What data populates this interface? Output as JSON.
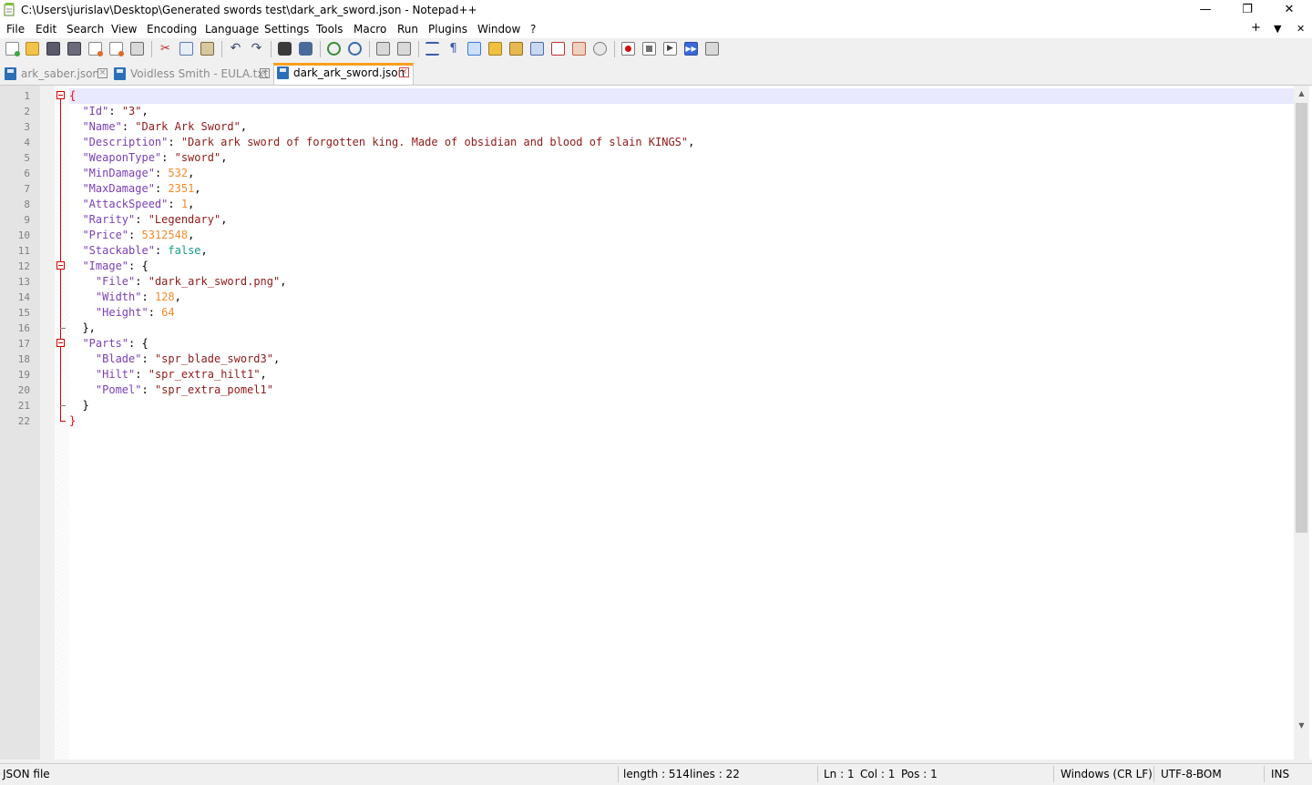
{
  "window": {
    "title": "C:\\Users\\jurislav\\Desktop\\Generated swords test\\dark_ark_sword.json - Notepad++",
    "minimize": "—",
    "maximize": "❐",
    "close": "✕"
  },
  "menu": {
    "items": [
      "File",
      "Edit",
      "Search",
      "View",
      "Encoding",
      "Language",
      "Settings",
      "Tools",
      "Macro",
      "Run",
      "Plugins",
      "Window",
      "?"
    ],
    "right_plus": "+",
    "right_down": "▼",
    "right_close": "✕"
  },
  "tabs": [
    {
      "label": "ark_saber.json",
      "active": false,
      "close": "×"
    },
    {
      "label": "Voidless Smith - EULA.txt",
      "active": false,
      "close": "×"
    },
    {
      "label": "dark_ark_sword.json",
      "active": true,
      "close": "×"
    }
  ],
  "editor": {
    "line_numbers": [
      "1",
      "2",
      "3",
      "4",
      "5",
      "6",
      "7",
      "8",
      "9",
      "10",
      "11",
      "12",
      "13",
      "14",
      "15",
      "16",
      "17",
      "18",
      "19",
      "20",
      "21",
      "22"
    ],
    "lines": [
      [
        {
          "t": "{",
          "c": "brace-hi"
        }
      ],
      [
        {
          "t": "  ",
          "c": "p"
        },
        {
          "t": "\"Id\"",
          "c": "k"
        },
        {
          "t": ": ",
          "c": "p"
        },
        {
          "t": "\"3\"",
          "c": "s"
        },
        {
          "t": ",",
          "c": "p"
        }
      ],
      [
        {
          "t": "  ",
          "c": "p"
        },
        {
          "t": "\"Name\"",
          "c": "k"
        },
        {
          "t": ": ",
          "c": "p"
        },
        {
          "t": "\"Dark Ark Sword\"",
          "c": "s"
        },
        {
          "t": ",",
          "c": "p"
        }
      ],
      [
        {
          "t": "  ",
          "c": "p"
        },
        {
          "t": "\"Description\"",
          "c": "k"
        },
        {
          "t": ": ",
          "c": "p"
        },
        {
          "t": "\"Dark ark sword of forgotten king. Made of obsidian and blood of slain KINGS\"",
          "c": "s"
        },
        {
          "t": ",",
          "c": "p"
        }
      ],
      [
        {
          "t": "  ",
          "c": "p"
        },
        {
          "t": "\"WeaponType\"",
          "c": "k"
        },
        {
          "t": ": ",
          "c": "p"
        },
        {
          "t": "\"sword\"",
          "c": "s"
        },
        {
          "t": ",",
          "c": "p"
        }
      ],
      [
        {
          "t": "  ",
          "c": "p"
        },
        {
          "t": "\"MinDamage\"",
          "c": "k"
        },
        {
          "t": ": ",
          "c": "p"
        },
        {
          "t": "532",
          "c": "n"
        },
        {
          "t": ",",
          "c": "p"
        }
      ],
      [
        {
          "t": "  ",
          "c": "p"
        },
        {
          "t": "\"MaxDamage\"",
          "c": "k"
        },
        {
          "t": ": ",
          "c": "p"
        },
        {
          "t": "2351",
          "c": "n"
        },
        {
          "t": ",",
          "c": "p"
        }
      ],
      [
        {
          "t": "  ",
          "c": "p"
        },
        {
          "t": "\"AttackSpeed\"",
          "c": "k"
        },
        {
          "t": ": ",
          "c": "p"
        },
        {
          "t": "1",
          "c": "n"
        },
        {
          "t": ",",
          "c": "p"
        }
      ],
      [
        {
          "t": "  ",
          "c": "p"
        },
        {
          "t": "\"Rarity\"",
          "c": "k"
        },
        {
          "t": ": ",
          "c": "p"
        },
        {
          "t": "\"Legendary\"",
          "c": "s"
        },
        {
          "t": ",",
          "c": "p"
        }
      ],
      [
        {
          "t": "  ",
          "c": "p"
        },
        {
          "t": "\"Price\"",
          "c": "k"
        },
        {
          "t": ": ",
          "c": "p"
        },
        {
          "t": "5312548",
          "c": "n"
        },
        {
          "t": ",",
          "c": "p"
        }
      ],
      [
        {
          "t": "  ",
          "c": "p"
        },
        {
          "t": "\"Stackable\"",
          "c": "k"
        },
        {
          "t": ": ",
          "c": "p"
        },
        {
          "t": "false",
          "c": "b"
        },
        {
          "t": ",",
          "c": "p"
        }
      ],
      [
        {
          "t": "  ",
          "c": "p"
        },
        {
          "t": "\"Image\"",
          "c": "k"
        },
        {
          "t": ": {",
          "c": "p"
        }
      ],
      [
        {
          "t": "    ",
          "c": "p"
        },
        {
          "t": "\"File\"",
          "c": "k"
        },
        {
          "t": ": ",
          "c": "p"
        },
        {
          "t": "\"dark_ark_sword.png\"",
          "c": "s"
        },
        {
          "t": ",",
          "c": "p"
        }
      ],
      [
        {
          "t": "    ",
          "c": "p"
        },
        {
          "t": "\"Width\"",
          "c": "k"
        },
        {
          "t": ": ",
          "c": "p"
        },
        {
          "t": "128",
          "c": "n"
        },
        {
          "t": ",",
          "c": "p"
        }
      ],
      [
        {
          "t": "    ",
          "c": "p"
        },
        {
          "t": "\"Height\"",
          "c": "k"
        },
        {
          "t": ": ",
          "c": "p"
        },
        {
          "t": "64",
          "c": "n"
        }
      ],
      [
        {
          "t": "  },",
          "c": "p"
        }
      ],
      [
        {
          "t": "  ",
          "c": "p"
        },
        {
          "t": "\"Parts\"",
          "c": "k"
        },
        {
          "t": ": {",
          "c": "p"
        }
      ],
      [
        {
          "t": "    ",
          "c": "p"
        },
        {
          "t": "\"Blade\"",
          "c": "k"
        },
        {
          "t": ": ",
          "c": "p"
        },
        {
          "t": "\"spr_blade_sword3\"",
          "c": "s"
        },
        {
          "t": ",",
          "c": "p"
        }
      ],
      [
        {
          "t": "    ",
          "c": "p"
        },
        {
          "t": "\"Hilt\"",
          "c": "k"
        },
        {
          "t": ": ",
          "c": "p"
        },
        {
          "t": "\"spr_extra_hilt1\"",
          "c": "s"
        },
        {
          "t": ",",
          "c": "p"
        }
      ],
      [
        {
          "t": "    ",
          "c": "p"
        },
        {
          "t": "\"Pomel\"",
          "c": "k"
        },
        {
          "t": ": ",
          "c": "p"
        },
        {
          "t": "\"spr_extra_pomel1\"",
          "c": "s"
        }
      ],
      [
        {
          "t": "  }",
          "c": "p"
        }
      ],
      [
        {
          "t": "}",
          "c": "brace-hi"
        }
      ]
    ]
  },
  "status": {
    "file_type": "JSON file",
    "length": "length : 514",
    "lines": "lines : 22",
    "ln": "Ln : 1",
    "col": "Col : 1",
    "pos": "Pos : 1",
    "eol": "Windows (CR LF)",
    "encoding": "UTF-8-BOM",
    "mode": "INS"
  },
  "colors": {
    "key": "#7a3fb6",
    "string": "#8e1a1a",
    "number": "#f18a2a",
    "boolean": "#169a86",
    "active_tab_accent": "#fa9f1b",
    "fold": "#d40000"
  },
  "toolbar_icons": [
    "new-file-icon",
    "open-file-icon",
    "save-icon",
    "save-all-icon",
    "close-icon",
    "close-all-icon",
    "print-icon",
    "cut-icon",
    "copy-icon",
    "paste-icon",
    "undo-icon",
    "redo-icon",
    "find-icon",
    "replace-icon",
    "zoom-in-icon",
    "zoom-out-icon",
    "sync-vertical-icon",
    "sync-horizontal-icon",
    "word-wrap-icon",
    "show-all-chars-icon",
    "indent-guide-icon",
    "user-lang-icon",
    "doc-map-icon",
    "function-list-icon",
    "folder-workspace-icon",
    "doc-switcher-icon",
    "monitor-icon",
    "record-macro-icon",
    "stop-macro-icon",
    "play-macro-icon",
    "run-macro-multiple-icon",
    "save-macro-icon"
  ]
}
